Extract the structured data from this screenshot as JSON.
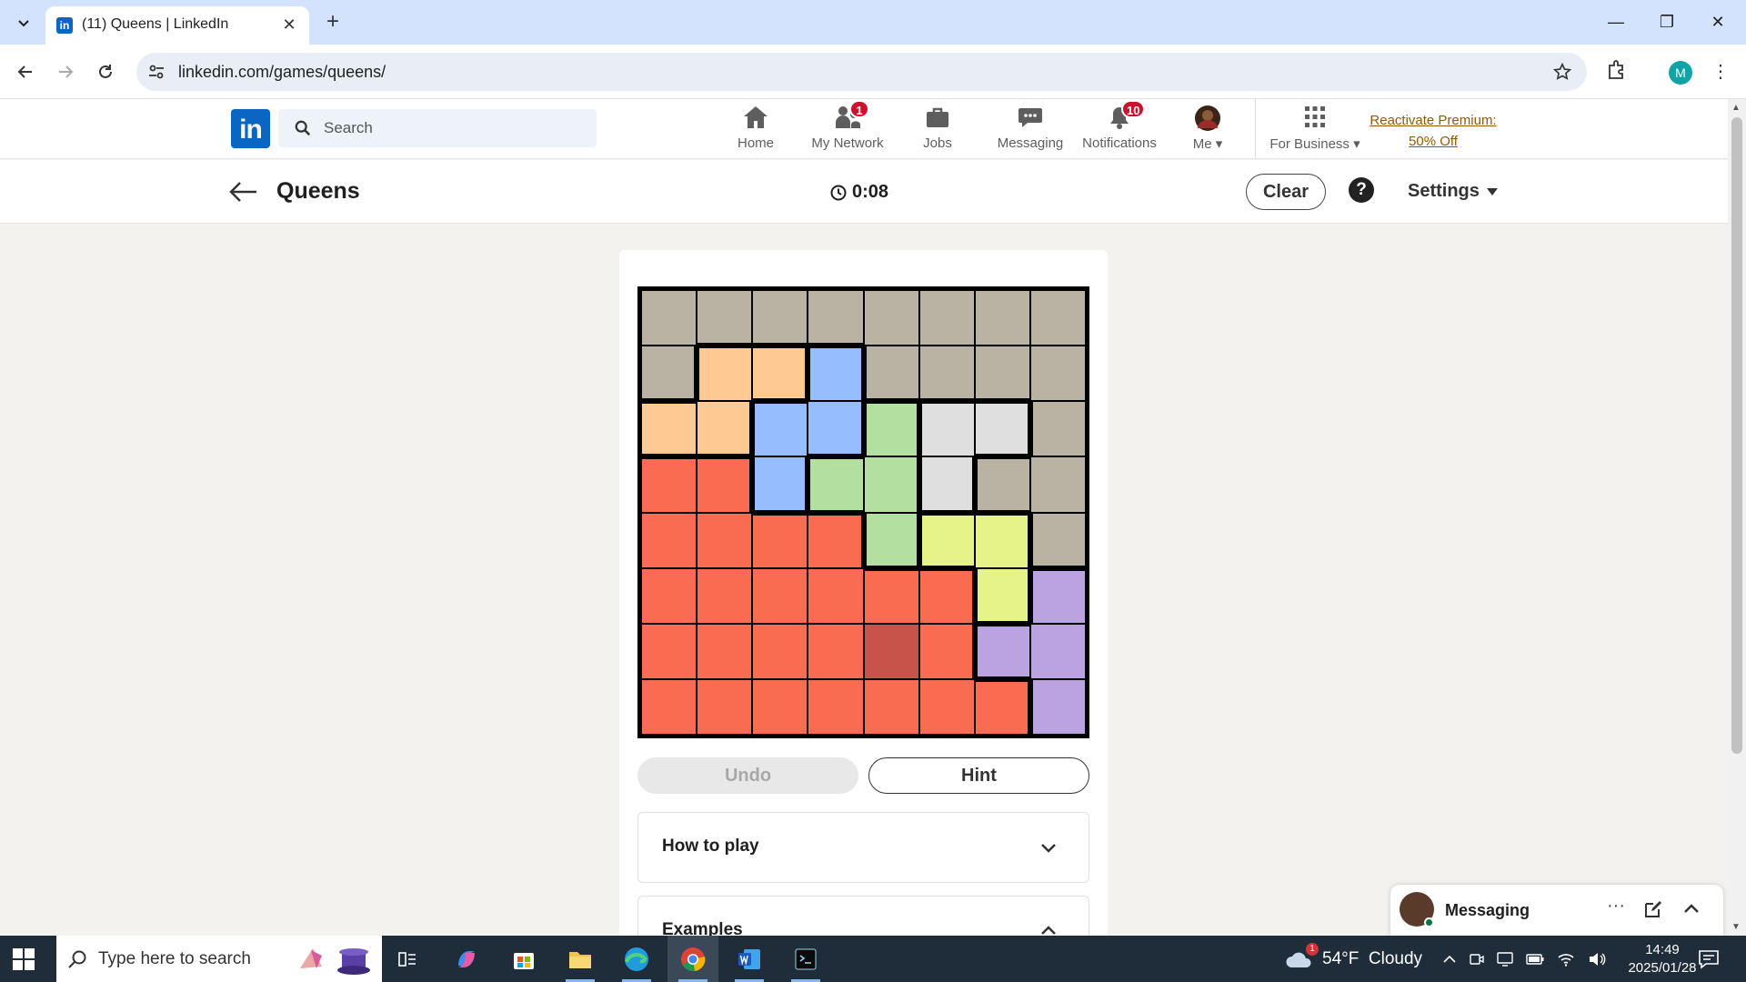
{
  "browser": {
    "tab_title": "(11) Queens | LinkedIn",
    "favicon_text": "in",
    "close_glyph": "✕",
    "new_tab_glyph": "+",
    "url": "linkedin.com/games/queens/",
    "profile_initial": "M",
    "window_minimize": "—",
    "window_restore": "❐",
    "window_close": "✕",
    "menu_glyph": "⋮"
  },
  "linkedin_nav": {
    "logo_text": "in",
    "search_placeholder": "Search",
    "items": [
      {
        "label": "Home",
        "icon": "home-icon",
        "badge": ""
      },
      {
        "label": "My Network",
        "icon": "people-icon",
        "badge": "1"
      },
      {
        "label": "Jobs",
        "icon": "briefcase-icon",
        "badge": ""
      },
      {
        "label": "Messaging",
        "icon": "chat-icon",
        "badge": ""
      },
      {
        "label": "Notifications",
        "icon": "bell-icon",
        "badge": "10"
      },
      {
        "label": "Me",
        "icon": "avatar",
        "badge": ""
      },
      {
        "label": "For Business",
        "icon": "grid-icon",
        "badge": ""
      }
    ],
    "premium_line1": "Reactivate Premium:",
    "premium_line2": "50% Off"
  },
  "game_header": {
    "title": "Queens",
    "timer": "0:08",
    "clear_label": "Clear",
    "help_glyph": "?",
    "settings_label": "Settings"
  },
  "board": {
    "size": 8,
    "colors": {
      "T": "#bab3a4",
      "O": "#ffc993",
      "B": "#96beff",
      "G": "#b3dfa0",
      "W": "#dfdfdf",
      "Y": "#e6f388",
      "R": "#f96c51",
      "P": "#bba3e2"
    },
    "rows": [
      "TTTTTTTT",
      "TOOBTTTT",
      "OOBBGWWT",
      "RRBGGWTT",
      "RRRRGYYT",
      "RRRRRRYP",
      "RRRRRRPP",
      "RRRRRRRP"
    ],
    "highlighted_cell": {
      "row": 6,
      "col": 4,
      "color": "#c7534a"
    }
  },
  "controls": {
    "undo_label": "Undo",
    "hint_label": "Hint"
  },
  "accordions": [
    {
      "label": "How to play",
      "state": "collapsed"
    },
    {
      "label": "Examples",
      "state": "expanded"
    }
  ],
  "messaging": {
    "title": "Messaging",
    "more_glyph": "···"
  },
  "taskbar": {
    "search_placeholder": "Type here to search",
    "weather": "54°F  Cloudy",
    "weather_badge": "1",
    "time": "14:49",
    "date": "2025/01/28"
  }
}
